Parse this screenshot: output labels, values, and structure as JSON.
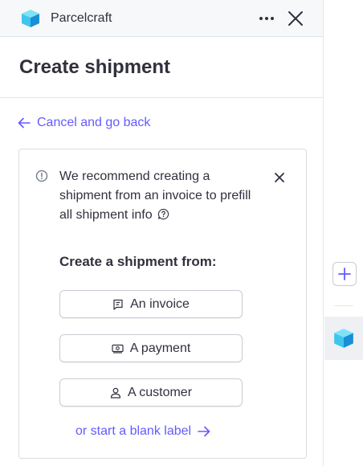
{
  "header": {
    "app_name": "Parcelcraft",
    "logo_icon": "parcelcraft-cube-icon",
    "more_icon": "more-horizontal-icon",
    "close_icon": "close-icon"
  },
  "page": {
    "title": "Create shipment"
  },
  "back_link": {
    "label": "Cancel and go back",
    "icon": "arrow-left-icon"
  },
  "notice": {
    "text": "We recommend creating a shipment from an invoice to prefill all shipment info",
    "icon": "info-icon",
    "help_icon": "help-icon",
    "dismiss_icon": "close-icon"
  },
  "create_from": {
    "title": "Create a shipment from:",
    "options": [
      {
        "label": "An invoice",
        "icon": "invoice-icon"
      },
      {
        "label": "A payment",
        "icon": "payment-icon"
      },
      {
        "label": "A customer",
        "icon": "customer-icon"
      }
    ]
  },
  "blank_link": {
    "label": "or start a blank label",
    "icon": "arrow-right-icon"
  },
  "side_rail": {
    "add_icon": "plus-icon",
    "app_icon": "parcelcraft-cube-icon"
  },
  "colors": {
    "accent": "#635bff",
    "text": "#30313d",
    "border": "#e3e6ea",
    "header_bg": "#f6f8fa",
    "logo_light": "#3fd0f0",
    "logo_dark": "#1a8fd6"
  }
}
